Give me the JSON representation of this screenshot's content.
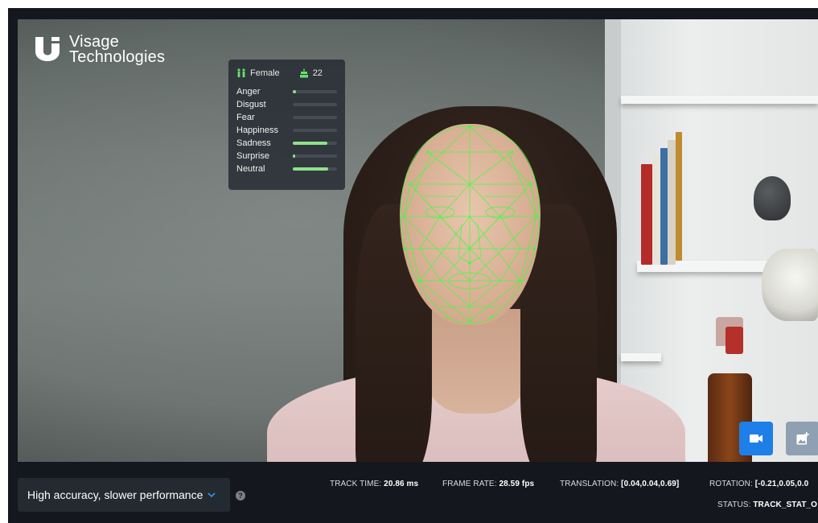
{
  "logo": {
    "line1": "Visage",
    "line2": "Technologies"
  },
  "analysis": {
    "gender": "Female",
    "age": "22",
    "emotions": [
      {
        "label": "Anger",
        "value": 0.08
      },
      {
        "label": "Disgust",
        "value": 0.0
      },
      {
        "label": "Fear",
        "value": 0.0
      },
      {
        "label": "Happiness",
        "value": 0.0
      },
      {
        "label": "Sadness",
        "value": 0.78
      },
      {
        "label": "Surprise",
        "value": 0.04
      },
      {
        "label": "Neutral",
        "value": 0.8
      }
    ]
  },
  "controls": {
    "mode_selected": "High accuracy, slower performance",
    "help_glyph": "?"
  },
  "stats": {
    "track_time_label": "TRACK TIME:",
    "track_time_value": "20.86 ms",
    "frame_rate_label": "FRAME RATE:",
    "frame_rate_value": "28.59 fps",
    "translation_label": "TRANSLATION:",
    "translation_value": "[0.04,0.04,0.69]",
    "rotation_label": "ROTATION:",
    "rotation_value": "[-0.21,0.05,0.0",
    "status_label": "STATUS:",
    "status_value": "TRACK_STAT_O"
  },
  "colors": {
    "accent_blue": "#1f7fe8",
    "mesh_green": "#3cff3c",
    "emotion_bar": "#8ee28b"
  },
  "icons": {
    "gender": "female-male-icon",
    "age": "age-cake-icon",
    "video": "video-camera-icon",
    "image": "add-image-icon"
  }
}
